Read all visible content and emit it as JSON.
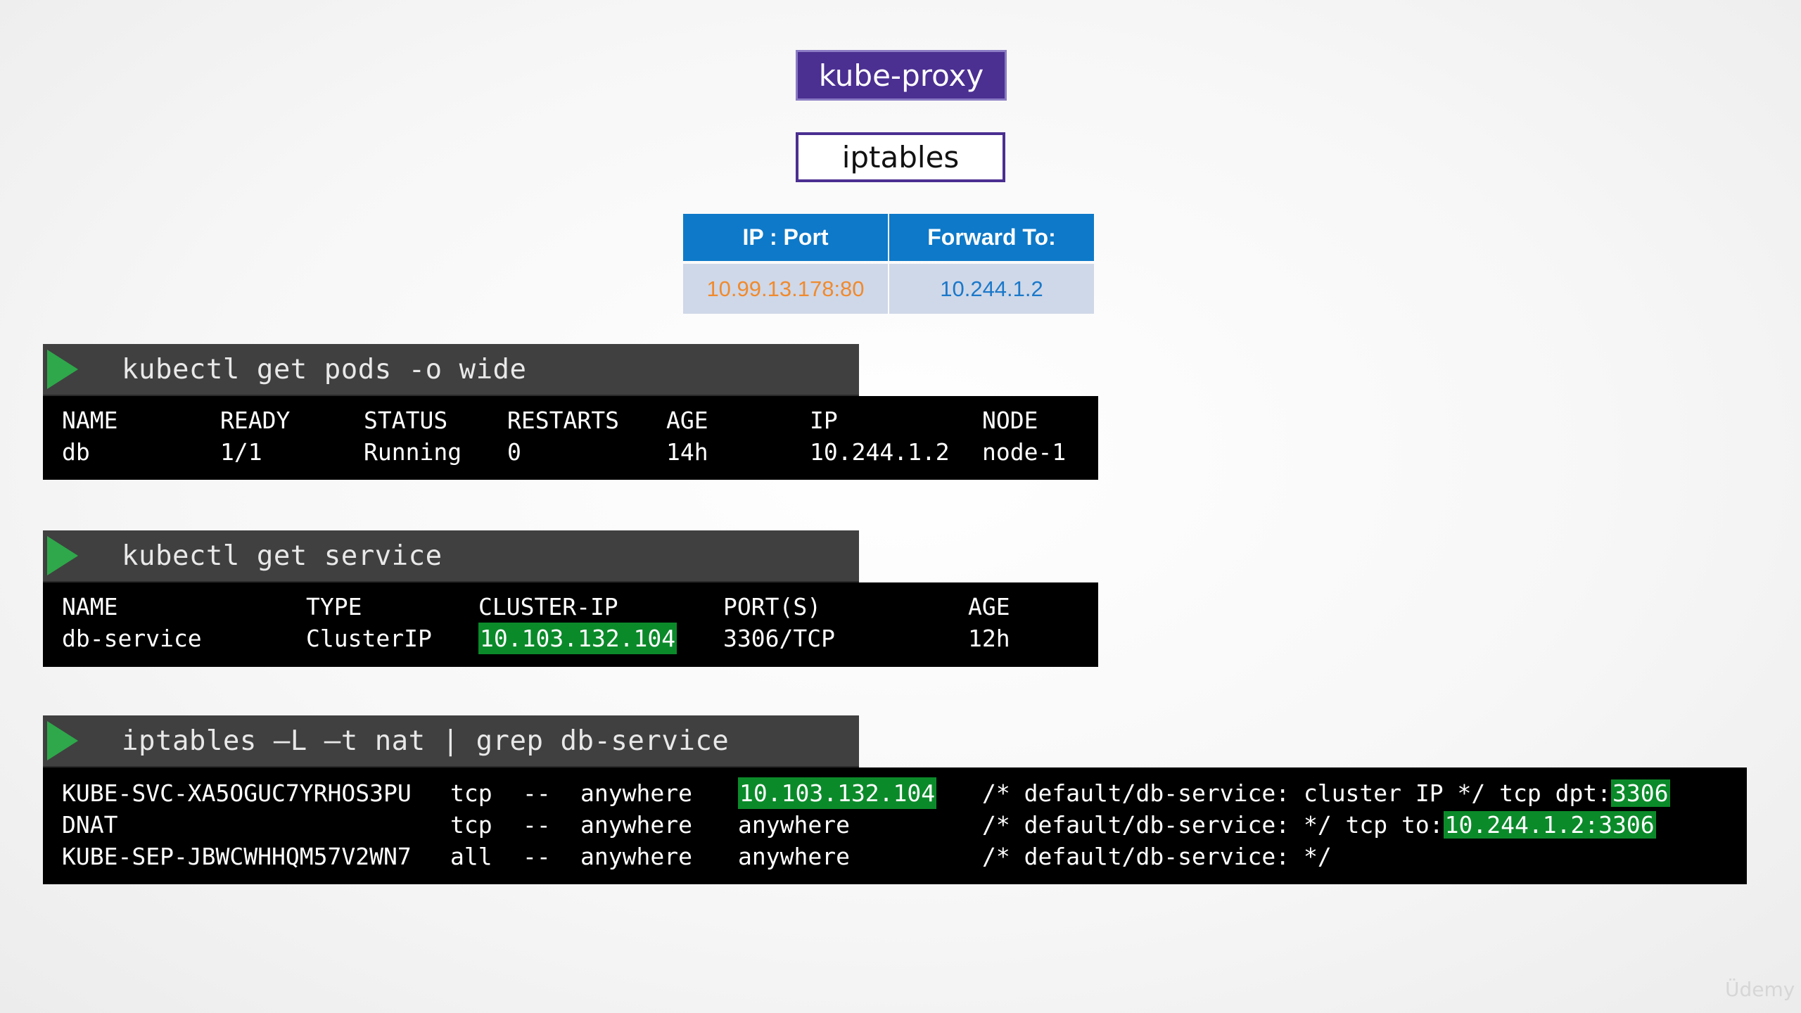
{
  "top": {
    "kube_proxy_label": "kube-proxy",
    "iptables_label": "iptables"
  },
  "forward_table": {
    "headers": [
      "IP : Port",
      "Forward To:"
    ],
    "row": [
      "10.99.13.178:80",
      "10.244.1.2"
    ]
  },
  "pods": {
    "command": "kubectl get pods -o wide",
    "headers": [
      "NAME",
      "READY",
      "STATUS",
      "RESTARTS",
      "AGE",
      "IP",
      "NODE"
    ],
    "row": [
      "db",
      "1/1",
      "Running",
      "0",
      "14h",
      "10.244.1.2",
      "node-1"
    ]
  },
  "service": {
    "command": "kubectl get service",
    "headers": [
      "NAME",
      "TYPE",
      "CLUSTER-IP",
      "PORT(S)",
      "AGE"
    ],
    "row": [
      "db-service",
      "ClusterIP",
      "10.103.132.104",
      "3306/TCP",
      "12h"
    ]
  },
  "iptables_cmd": {
    "command": "iptables –L –t nat | grep db-service",
    "rows": [
      {
        "chain": "KUBE-SVC-XA5OGUC7YRHOS3PU",
        "prot": "tcp",
        "opt": "--",
        "source": "anywhere",
        "dest": "10.103.132.104",
        "comment": "/* default/db-service: cluster IP */ tcp dpt:",
        "comment_hl": "3306"
      },
      {
        "chain": "DNAT",
        "prot": "tcp",
        "opt": "--",
        "source": "anywhere",
        "dest": "anywhere",
        "comment": "/* default/db-service: */ tcp to:",
        "comment_hl": "10.244.1.2:3306"
      },
      {
        "chain": "KUBE-SEP-JBWCWHHQM57V2WN7",
        "prot": "all",
        "opt": "--",
        "source": "anywhere",
        "dest": "anywhere",
        "comment": "/* default/db-service: */",
        "comment_hl": ""
      }
    ]
  },
  "colors": {
    "kube_proxy_bg": "#4b2f91",
    "table_header_bg": "#0e79c8",
    "table_cell_bg": "#cfd8e8",
    "highlight_green": "#0b8a2a",
    "play_green": "#2ea84a"
  },
  "icons": {
    "command_prompt": "play-triangle-icon"
  },
  "watermark": "Üdemy"
}
